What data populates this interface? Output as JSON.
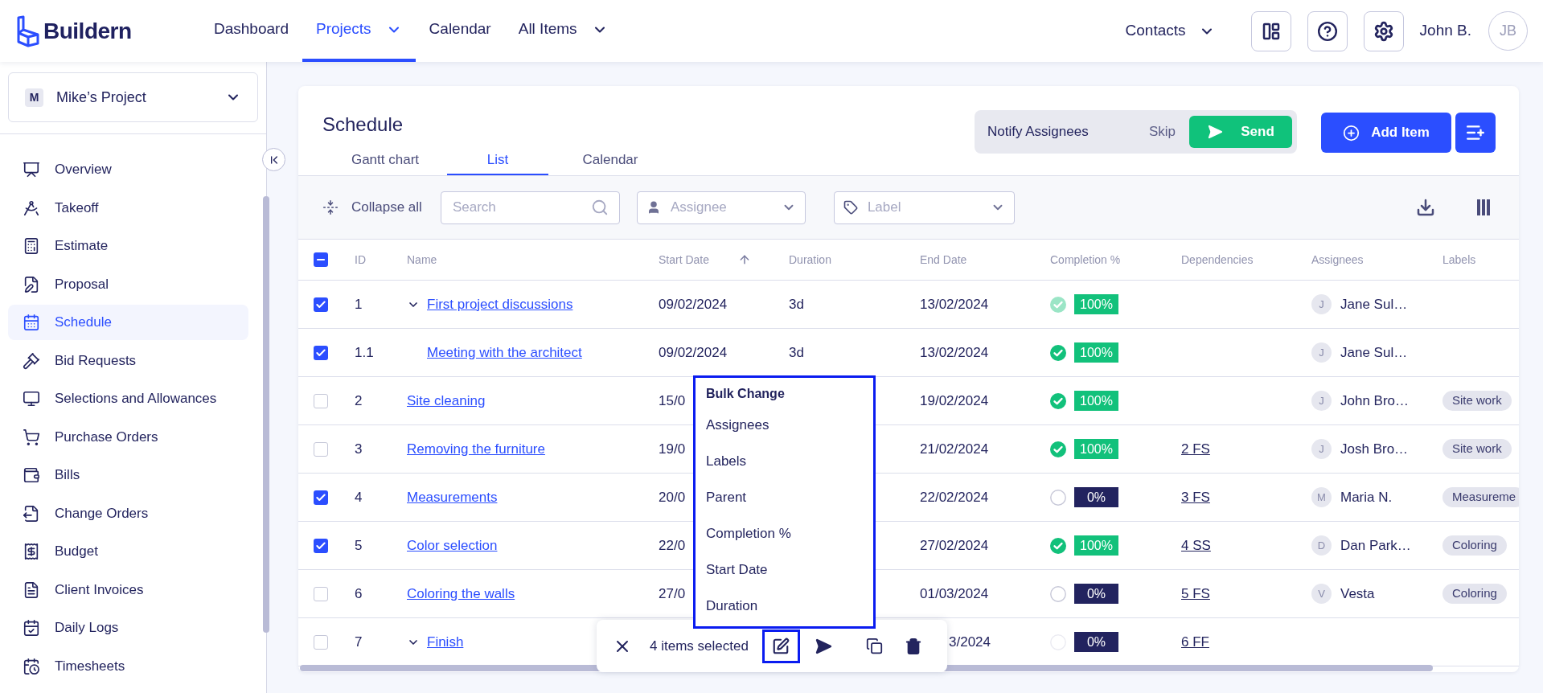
{
  "brand": {
    "name": "Buildern"
  },
  "top_nav": [
    {
      "label": "Dashboard",
      "selected": false,
      "has_menu": false
    },
    {
      "label": "Projects",
      "selected": true,
      "has_menu": true
    },
    {
      "label": "Calendar",
      "selected": false,
      "has_menu": false
    },
    {
      "label": "All Items",
      "selected": false,
      "has_menu": true
    }
  ],
  "contacts_menu": {
    "label": "Contacts"
  },
  "user": {
    "name": "John B.",
    "initials": "JB"
  },
  "project_selector": {
    "initial": "M",
    "name": "Mike’s Project"
  },
  "sidebar": {
    "items": [
      {
        "label": "Overview",
        "selected": false
      },
      {
        "label": "Takeoff",
        "selected": false
      },
      {
        "label": "Estimate",
        "selected": false
      },
      {
        "label": "Proposal",
        "selected": false
      },
      {
        "label": "Schedule",
        "selected": true
      },
      {
        "label": "Bid Requests",
        "selected": false
      },
      {
        "label": "Selections and Allowances",
        "selected": false
      },
      {
        "label": "Purchase Orders",
        "selected": false
      },
      {
        "label": "Bills",
        "selected": false
      },
      {
        "label": "Change Orders",
        "selected": false
      },
      {
        "label": "Budget",
        "selected": false
      },
      {
        "label": "Client Invoices",
        "selected": false
      },
      {
        "label": "Daily Logs",
        "selected": false
      },
      {
        "label": "Timesheets",
        "selected": false
      }
    ]
  },
  "page": {
    "title": "Schedule",
    "tabs": [
      {
        "label": "Gantt chart",
        "selected": false
      },
      {
        "label": "List",
        "selected": true
      },
      {
        "label": "Calendar",
        "selected": false
      }
    ]
  },
  "notify": {
    "label": "Notify Assignees",
    "skip": "Skip",
    "send": "Send"
  },
  "add_item": {
    "label": "Add Item"
  },
  "toolbar": {
    "collapse": "Collapse all",
    "search": {
      "placeholder": "Search"
    },
    "assignee": {
      "placeholder": "Assignee"
    },
    "label": {
      "placeholder": "Label"
    }
  },
  "table": {
    "select_all": {
      "indeterminate": true
    },
    "columns": [
      {
        "label": "ID"
      },
      {
        "label": "Name"
      },
      {
        "label": "Start Date",
        "sorted": true
      },
      {
        "label": "Duration"
      },
      {
        "label": "End Date"
      },
      {
        "label": "Completion %"
      },
      {
        "label": "Dependencies"
      },
      {
        "label": "Assignees"
      },
      {
        "label": "Labels"
      }
    ],
    "rows": [
      {
        "id": "1",
        "name": "First project discussions",
        "checked": true,
        "expanded": true,
        "start": "09/02/2024",
        "duration": "3d",
        "end": "13/02/2024",
        "done": true,
        "dimmed": true,
        "completion": "100%",
        "assignee": {
          "initial": "J",
          "name": "Jane Sul…"
        },
        "children": [
          {
            "id": "1.1",
            "name": "Meeting with the architect",
            "checked": true,
            "start": "09/02/2024",
            "duration": "3d",
            "end": "13/02/2024",
            "done": true,
            "dimmed": false,
            "completion": "100%",
            "assignee": {
              "initial": "J",
              "name": "Jane Sul…"
            }
          }
        ]
      },
      {
        "id": "2",
        "name": "Site cleaning",
        "checked": false,
        "start": "15/0",
        "end": "19/02/2024",
        "done": true,
        "dimmed": false,
        "completion": "100%",
        "assignee": {
          "initial": "J",
          "name": "John Bro…"
        },
        "label": "Site work"
      },
      {
        "id": "3",
        "name": "Removing the furniture",
        "checked": false,
        "start": "19/0",
        "end": "21/02/2024",
        "done": true,
        "dimmed": false,
        "completion": "100%",
        "dependency": "2 FS",
        "assignee": {
          "initial": "J",
          "name": "Josh Bro…"
        },
        "label": "Site work"
      },
      {
        "id": "4",
        "name": "Measurements",
        "checked": true,
        "start": "20/0",
        "end": "22/02/2024",
        "done": false,
        "dimmed": false,
        "completion": "0%",
        "dependency": "3 FS",
        "assignee": {
          "initial": "M",
          "name": "Maria N."
        },
        "label": "Measureme"
      },
      {
        "id": "5",
        "name": "Color selection",
        "checked": true,
        "start": "22/0",
        "end": "27/02/2024",
        "done": true,
        "dimmed": false,
        "completion": "100%",
        "dependency": "4 SS",
        "assignee": {
          "initial": "D",
          "name": "Dan Park…"
        },
        "label": "Coloring"
      },
      {
        "id": "6",
        "name": "Coloring the walls",
        "checked": false,
        "start": "27/0",
        "end": "01/03/2024",
        "done": false,
        "dimmed": false,
        "completion": "0%",
        "dependency": "5 FS",
        "assignee": {
          "initial": "V",
          "name": "Vesta"
        },
        "label": "Coloring"
      },
      {
        "id": "7",
        "name": "Finish",
        "checked": false,
        "expanded": true,
        "end": "3/2024",
        "done": false,
        "dimmed": true,
        "completion": "0%",
        "dependency": "6 FF"
      }
    ]
  },
  "bulk_menu": {
    "title": "Bulk Change",
    "items": [
      "Assignees",
      "Labels",
      "Parent",
      "Completion %",
      "Start Date",
      "Duration"
    ]
  },
  "selection_bar": {
    "count": "4 items selected",
    "edit_highlighted": true
  }
}
